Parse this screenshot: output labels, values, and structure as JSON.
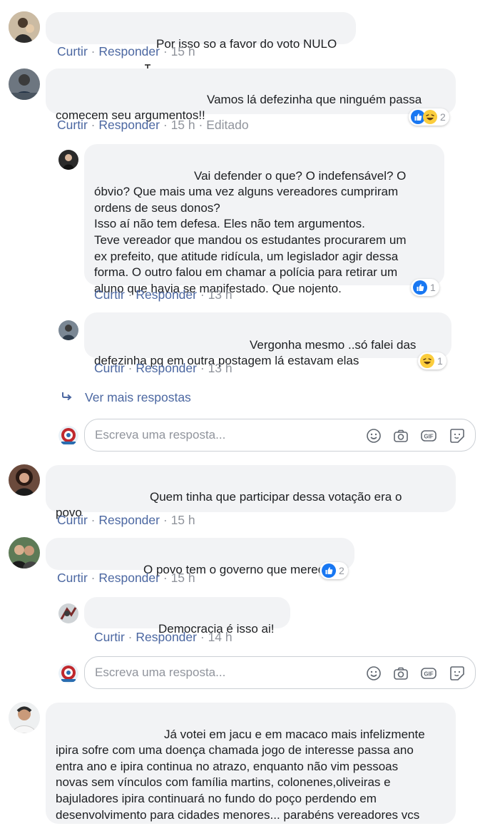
{
  "comments": [
    {
      "text": "Por isso so a favor do voto NULO",
      "actions": {
        "like": "Curtir",
        "reply": "Responder",
        "time": "15 h"
      }
    },
    {
      "text": "Vamos lá defezinha que ninguém passa\ncomecem seu argumentos!!",
      "actions": {
        "like": "Curtir",
        "reply": "Responder",
        "time": "15 h",
        "edited": "Editado"
      },
      "reaction_count": "2",
      "replies": [
        {
          "text": "Vai defender o que? O indefensável? O\nóbvio? Que mais uma vez alguns vereadores cumpriram\nordens de seus donos?\nIsso aí não tem defesa. Eles não tem argumentos.\nTeve vereador que mandou os estudantes procurarem um\nex prefeito, que atitude ridícula, um legislador agir dessa\nforma. O outro falou em chamar a polícia para retirar um\naluno que havia se manifestado. Que nojento.",
          "actions": {
            "like": "Curtir",
            "reply": "Responder",
            "time": "13 h"
          },
          "reaction_count": "1"
        },
        {
          "text": "Vergonha mesmo ..só falei das\ndefezinha pq em outra postagem lá estavam elas",
          "actions": {
            "like": "Curtir",
            "reply": "Responder",
            "time": "13 h"
          },
          "reaction_count": "1"
        }
      ],
      "more_replies": "Ver mais respostas",
      "reply_placeholder": "Escreva uma resposta..."
    },
    {
      "text": "Quem tinha que participar dessa votação era o\npovo",
      "actions": {
        "like": "Curtir",
        "reply": "Responder",
        "time": "15 h"
      }
    },
    {
      "text": "O povo tem o governo que merece.",
      "actions": {
        "like": "Curtir",
        "reply": "Responder",
        "time": "15 h"
      },
      "reaction_count": "2",
      "replies": [
        {
          "text": "Democracia é isso ai!",
          "actions": {
            "like": "Curtir",
            "reply": "Responder",
            "time": "14 h"
          }
        }
      ],
      "reply_placeholder": "Escreva uma resposta..."
    },
    {
      "text": "Já votei em jacu e em macaco mais infelizmente\nipira sofre com uma doença chamada jogo de interesse passa ano\nentra ano e ipira continua no atrazo, enquanto não vim pessoas\nnovas sem vínculos com família martins, colonenes,oliveiras e\nbajuladores ipira continuará no fundo do poço perdendo em\ndesenvolvimento para cidades menores... parabéns vereadores vcs\nprovaram que são a ipocresia em pessoa."
    }
  ],
  "colors": {
    "link": "#4b67a1",
    "meta": "#90949c",
    "bubble": "#f2f3f5",
    "like_blue": "#1877f2",
    "haha_yellow": "#fbcd3d"
  },
  "icons": [
    "like-icon",
    "haha-icon",
    "reply-arrow-icon",
    "emoji-icon",
    "camera-icon",
    "gif-icon",
    "sticker-icon"
  ]
}
